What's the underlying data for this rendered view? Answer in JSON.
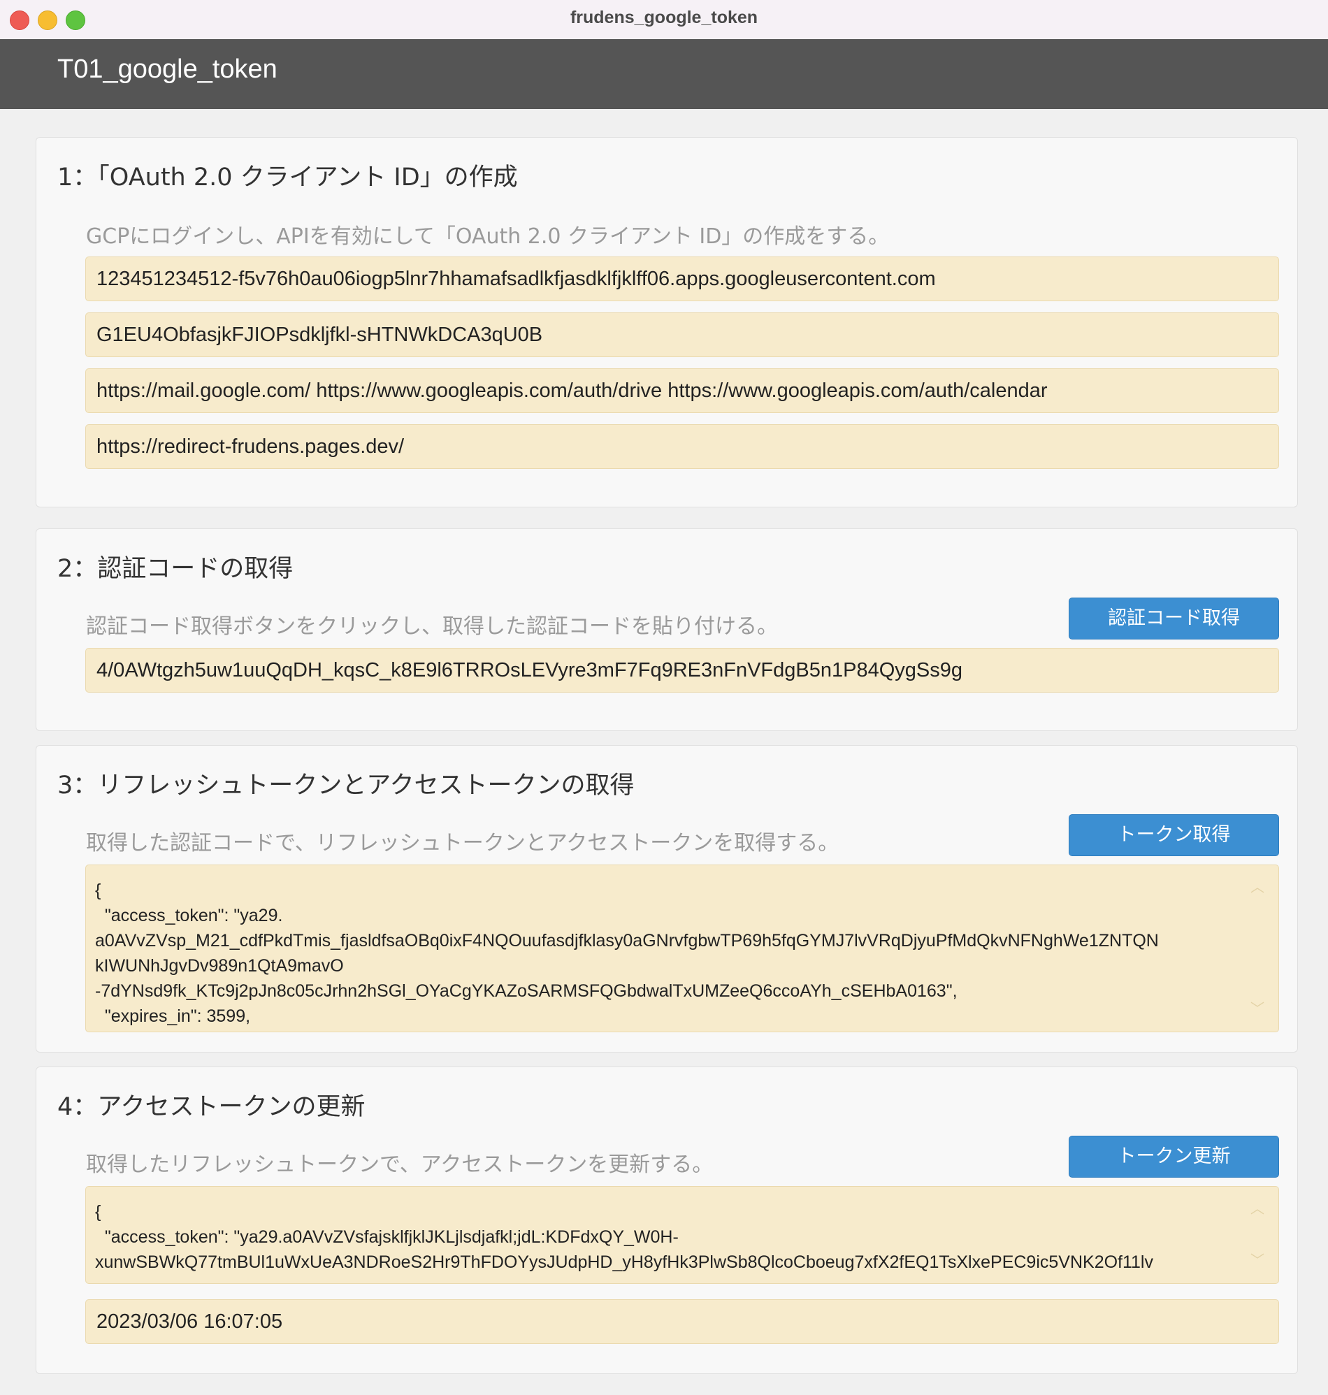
{
  "window": {
    "title": "frudens_google_token"
  },
  "app": {
    "title": "T01_google_token"
  },
  "sections": [
    {
      "title": "1：「OAuth 2.0 クライアント ID」の作成",
      "description": "GCPにログインし、APIを有効にして「OAuth 2.0 クライアント ID」の作成をする。",
      "fields": [
        "123451234512-f5v76h0au06iogp5lnr7hhamafsadlkfjasdklfjklff06.apps.googleusercontent.com",
        "G1EU4ObfasjkFJIOPsdkljfkl-sHTNWkDCA3qU0B",
        "https://mail.google.com/ https://www.googleapis.com/auth/drive https://www.googleapis.com/auth/calendar",
        "https://redirect-frudens.pages.dev/"
      ]
    },
    {
      "title": "2：認証コードの取得",
      "description": "認証コード取得ボタンをクリックし、取得した認証コードを貼り付ける。",
      "button_label": "認証コード取得",
      "field": "4/0AWtgzh5uw1uuQqDH_kqsC_k8E9l6TRROsLEVyre3mF7Fq9RE3nFnVFdgB5n1P84QygSs9g"
    },
    {
      "title": "3：リフレッシュトークンとアクセストークンの取得",
      "description": "取得した認証コードで、リフレッシュトークンとアクセストークンを取得する。",
      "button_label": "トークン取得",
      "textarea_lines": [
        "{",
        "  \"access_token\": \"ya29.",
        "a0AVvZVsp_M21_cdfPkdTmis_fjasldfsaOBq0ixF4NQOuufasdjfklasy0aGNrvfgbwTP69h5fqGYMJ7lvVRqDjyuPfMdQkvNFNghWe1ZNTQN",
        "kIWUNhJgvDv989n1QtA9mavO",
        "-7dYNsd9fk_KTc9j2pJn8c05cJrhn2hSGl_OYaCgYKAZoSARMSFQGbdwalTxUMZeeQ6ccoAYh_cSEHbA0163\",",
        "  \"expires_in\": 3599,"
      ]
    },
    {
      "title": "4：アクセストークンの更新",
      "description": "取得したリフレッシュトークンで、アクセストークンを更新する。",
      "button_label": "トークン更新",
      "textarea_lines": [
        "{",
        "  \"access_token\": \"ya29.a0AVvZVsfajsklfjklJKLjlsdjafkl;jdL:KDFdxQY_W0H-",
        "xunwSBWkQ77tmBUl1uWxUeA3NDRoeS2Hr9ThFDOYysJUdpHD_yH8yfHk3PlwSb8QlcoCboeug7xfX2fEQ1TsXlxePEC9ic5VNK2Of11lv"
      ],
      "timestamp": "2023/03/06 16:07:05"
    }
  ],
  "icons": {
    "scroll_up": "chevron-up-icon",
    "scroll_down": "chevron-down-icon"
  },
  "colors": {
    "header_bg": "#555555",
    "panel_bg": "#f8f8f8",
    "field_bg": "#f7ebcc",
    "button_bg": "#3c8fd2",
    "traffic_close": "#ee5b54",
    "traffic_min": "#f7bd31",
    "traffic_max": "#5ec440"
  }
}
